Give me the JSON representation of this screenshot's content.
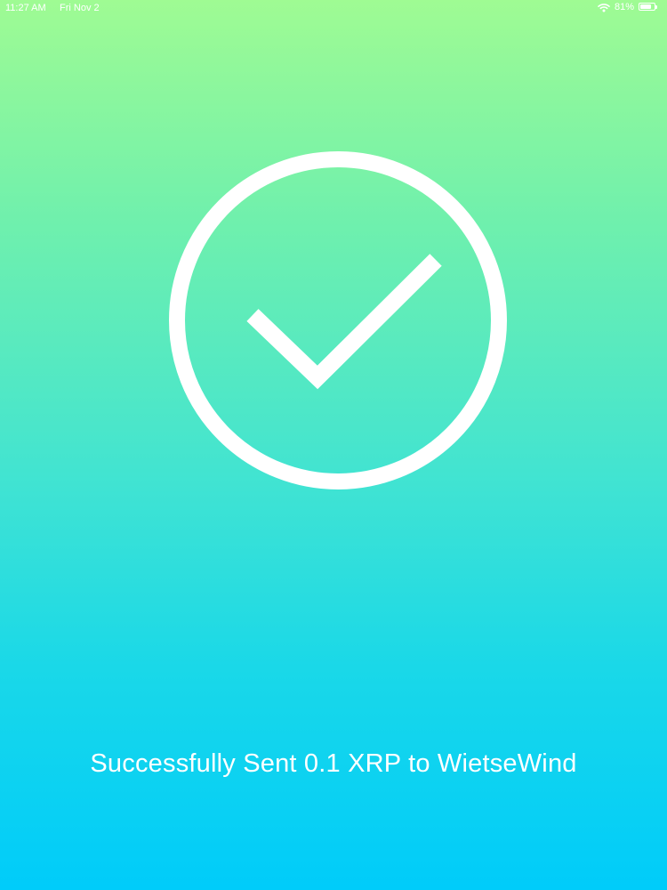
{
  "status_bar": {
    "time": "11:27 AM",
    "date": "Fri Nov 2",
    "battery_percent_label": "81%",
    "battery_level": 0.81,
    "wifi_icon": "wifi-icon",
    "battery_icon": "battery-icon"
  },
  "success": {
    "icon": "checkmark-circle-icon",
    "message": "Successfully Sent 0.1 XRP to WietseWind"
  },
  "colors": {
    "gradient_top": "#9ffb93",
    "gradient_bottom": "#00ccfa",
    "foreground": "#ffffff"
  }
}
